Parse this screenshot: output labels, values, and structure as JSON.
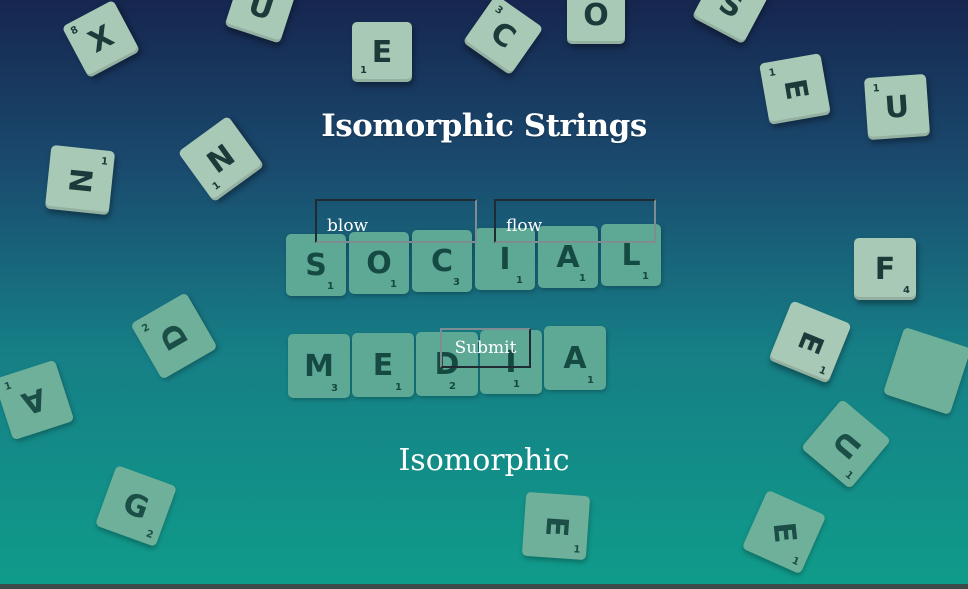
{
  "app": {
    "title": "Isomorphic Strings",
    "inputs": {
      "first_value": "blow",
      "second_value": "flow"
    },
    "submit_label": "Submit",
    "result_text": "Isomorphic"
  },
  "background": {
    "tiles": [
      {
        "letter": "X",
        "points": "8"
      },
      {
        "letter": "U",
        "points": ""
      },
      {
        "letter": "E",
        "points": "1"
      },
      {
        "letter": "C",
        "points": "3"
      },
      {
        "letter": "O",
        "points": ""
      },
      {
        "letter": "S",
        "points": ""
      },
      {
        "letter": "N",
        "points": "1"
      },
      {
        "letter": "N",
        "points": "1"
      },
      {
        "letter": "E",
        "points": "1"
      },
      {
        "letter": "U",
        "points": "1"
      },
      {
        "letter": "F",
        "points": "4"
      },
      {
        "letter": "D",
        "points": "2"
      },
      {
        "letter": "E",
        "points": "1"
      },
      {
        "letter": "A",
        "points": "1"
      },
      {
        "letter": "U",
        "points": "1"
      },
      {
        "letter": "G",
        "points": "2"
      },
      {
        "letter": "E",
        "points": "1"
      },
      {
        "letter": "E",
        "points": "1"
      },
      {
        "letter": "",
        "points": ""
      }
    ],
    "word_social": [
      {
        "letter": "S",
        "points": "1"
      },
      {
        "letter": "O",
        "points": "1"
      },
      {
        "letter": "C",
        "points": "3"
      },
      {
        "letter": "I",
        "points": "1"
      },
      {
        "letter": "A",
        "points": "1"
      },
      {
        "letter": "L",
        "points": "1"
      }
    ],
    "word_media": [
      {
        "letter": "M",
        "points": "3"
      },
      {
        "letter": "E",
        "points": "1"
      },
      {
        "letter": "D",
        "points": "2"
      },
      {
        "letter": "I",
        "points": "1"
      },
      {
        "letter": "A",
        "points": "1"
      }
    ],
    "colors": {
      "gradient_top": "#16264f",
      "gradient_bottom": "#0f9c8a",
      "tile": "#a9c9b7"
    }
  }
}
